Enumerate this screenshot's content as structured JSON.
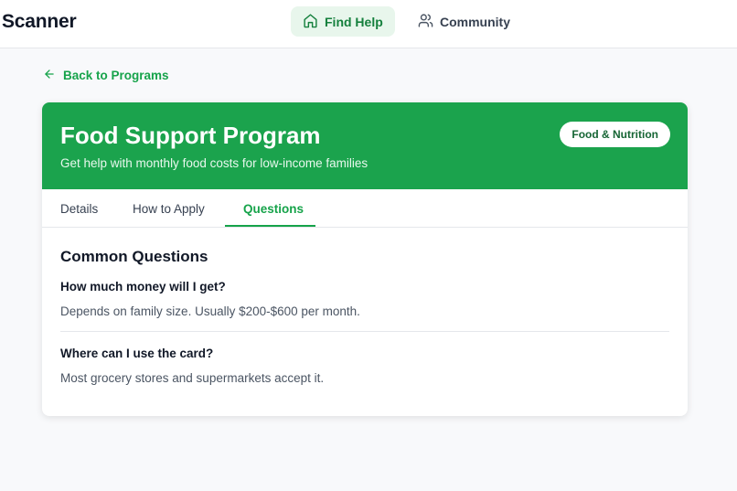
{
  "app": {
    "brand": "Scanner"
  },
  "nav": {
    "find_help": "Find Help",
    "community": "Community"
  },
  "back_link": "Back to Programs",
  "program": {
    "title": "Food Support Program",
    "subtitle": "Get help with monthly food costs for low-income families",
    "category": "Food & Nutrition"
  },
  "tabs": [
    {
      "label": "Details"
    },
    {
      "label": "How to Apply"
    },
    {
      "label": "Questions"
    }
  ],
  "active_tab": "Questions",
  "faq": {
    "title": "Common Questions",
    "items": [
      {
        "question": "How much money will I get?",
        "answer": "Depends on family size. Usually $200-$600 per month."
      },
      {
        "question": "Where can I use the card?",
        "answer": "Most grocery stores and supermarkets accept it."
      }
    ]
  },
  "colors": {
    "accent": "#16a34a",
    "hero": "#1ba34d",
    "nav_active_bg": "#e8f6ec"
  },
  "icons": {
    "find_help": "home-icon",
    "community": "users-icon",
    "back": "arrow-left-icon"
  }
}
